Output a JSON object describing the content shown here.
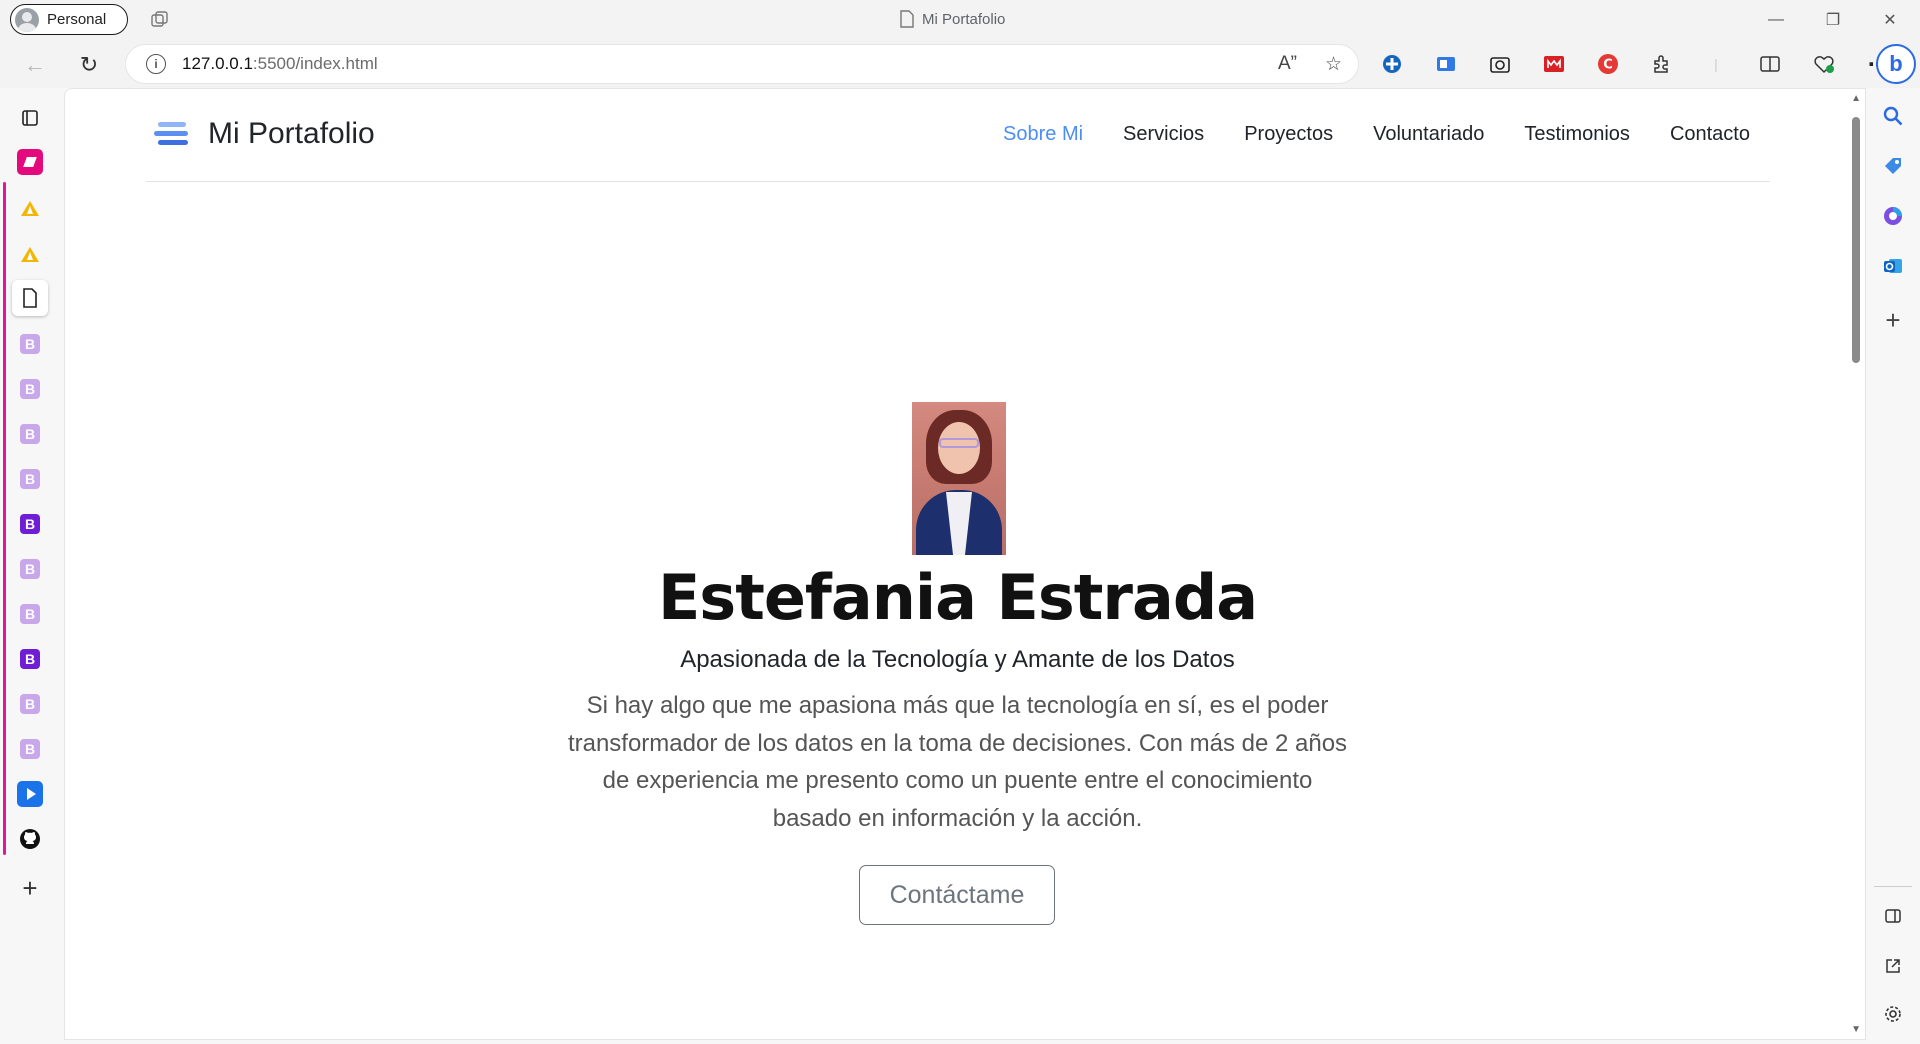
{
  "browser": {
    "profile_label": "Personal",
    "window_title": "Mi Portafolio",
    "url_host": "127.0.0.1",
    "url_rest": ":5500/index.html",
    "read_aloud_icon": "read-aloud-icon",
    "favorites_icon": "star-icon"
  },
  "vertical_tabs": {
    "b_label": "B"
  },
  "site": {
    "brand": "Mi Portafolio",
    "nav": [
      "Sobre Mi",
      "Servicios",
      "Proyectos",
      "Voluntariado",
      "Testimonios",
      "Contacto"
    ],
    "active_nav": "Sobre Mi",
    "accent_color": "#4c8df6"
  },
  "hero": {
    "name": "Estefania Estrada",
    "subtitle": "Apasionada de la Tecnología y Amante de los Datos",
    "text_lines": [
      "Si hay algo que me apasiona más que la tecnología en sí, es el poder",
      "transformador de los datos en la toma de decisiones. Con más de 2 años",
      "de experiencia me presento como un puente entre el conocimiento",
      "basado en información y la acción."
    ],
    "cta_label": "Contáctame"
  }
}
